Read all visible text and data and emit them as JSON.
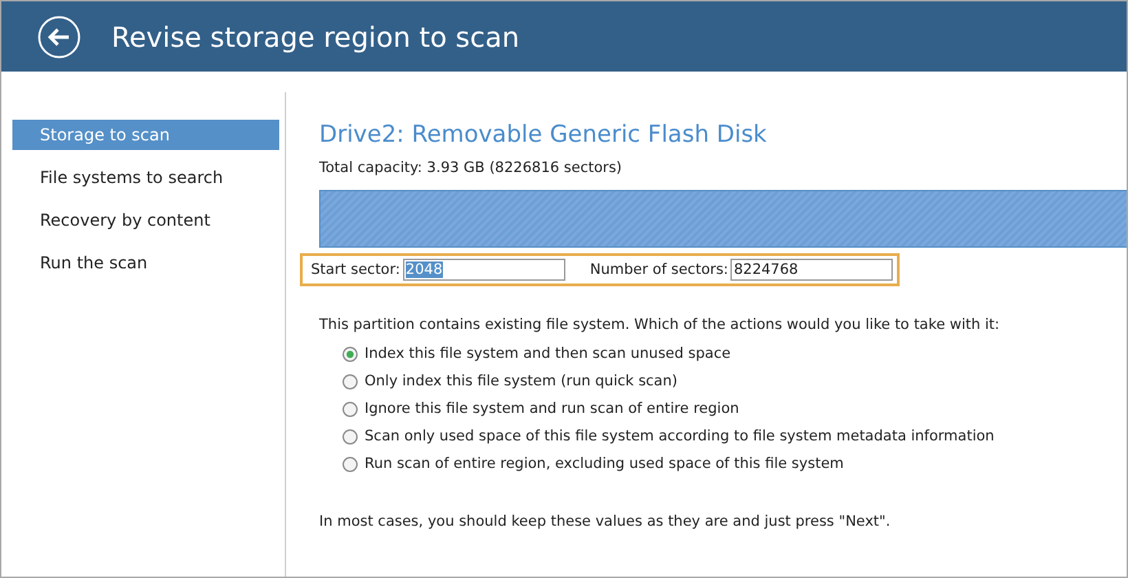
{
  "header": {
    "title": "Revise storage region to scan"
  },
  "sidebar": {
    "items": [
      {
        "label": "Storage to scan",
        "selected": true
      },
      {
        "label": "File systems to search",
        "selected": false
      },
      {
        "label": "Recovery by content",
        "selected": false
      },
      {
        "label": "Run the scan",
        "selected": false
      }
    ]
  },
  "drive": {
    "title": "Drive2: Removable Generic Flash Disk",
    "capacity": "Total capacity: 3.93 GB (8226816 sectors)"
  },
  "region": {
    "start_label": "Start sector:",
    "start_value": "2048",
    "count_label": "Number of sectors:",
    "count_value": "8224768"
  },
  "question": "This partition contains existing file system. Which of the actions would you like to take with it:",
  "options": [
    {
      "label": "Index this file system and then scan unused space",
      "selected": true
    },
    {
      "label": "Only index this file system (run quick scan)",
      "selected": false
    },
    {
      "label": "Ignore this file system and run scan of entire region",
      "selected": false
    },
    {
      "label": "Scan only used space of this file system according to file system metadata information",
      "selected": false
    },
    {
      "label": "Run scan of entire region, excluding used space of this file system",
      "selected": false
    }
  ],
  "hint": "In most cases, you should keep these values as they are and just press \"Next\"."
}
